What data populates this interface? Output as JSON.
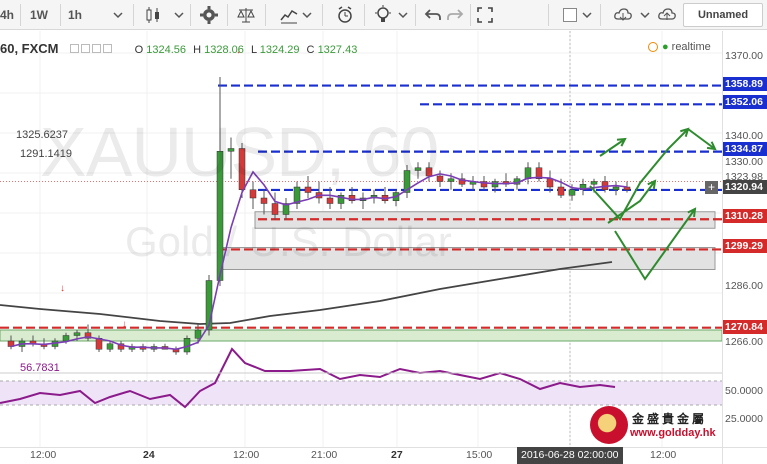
{
  "toolbar": {
    "items": [
      {
        "label": "4h"
      },
      {
        "label": "1W"
      },
      {
        "label": "1h"
      }
    ],
    "profile": "Unnamed"
  },
  "legend": {
    "symbol": "60, FXCM",
    "o_key": "O",
    "o_val": "1324.56",
    "h_key": "H",
    "h_val": "1328.06",
    "l_key": "L",
    "l_val": "1324.29",
    "c_key": "C",
    "c_val": "1327.43",
    "study1": "1325.6237",
    "study2": "1291.1419",
    "realtime": "realtime"
  },
  "watermark": {
    "symbol": "XAUUSD, 60",
    "desc": "Gold / U.S. Dollar"
  },
  "rsi": {
    "value": "56.7831"
  },
  "price_axis": {
    "ticks": [
      "1370.00",
      "1340.00",
      "1330.00",
      "1286.00",
      "1266.00",
      "50.0000",
      "25.0000"
    ],
    "labels": {
      "blue1": "1358.89",
      "blue2": "1352.06",
      "blue3": "1334.87",
      "current": "1320.94",
      "red1": "1310.28",
      "red2": "1299.29",
      "red3": "1270.84",
      "gray": "1323.98"
    }
  },
  "time_axis": {
    "ticks": [
      "12:00",
      "24",
      "12:00",
      "21:00",
      "27",
      "15:00",
      "12:00"
    ],
    "cursor": "2016-06-28 02:00:00"
  },
  "logo": {
    "cn": "金盛貴金屬",
    "url": "www.goldday.hk"
  },
  "colors": {
    "blue": "#1a2fd0",
    "red": "#d42a2a",
    "green": "#2e8b2e",
    "candle_red": "#d43a3a",
    "candle_green": "#3a9a3a",
    "rsi": "#8b1a8b"
  },
  "chart_data": {
    "type": "candlestick",
    "x": [
      "12:00",
      "24",
      "12:00",
      "21:00",
      "27",
      "15:00",
      "12:00"
    ],
    "ylim": [
      1260,
      1372
    ],
    "levels": [
      {
        "price": 1358.89,
        "color": "blue"
      },
      {
        "price": 1352.06,
        "color": "blue"
      },
      {
        "price": 1334.87,
        "color": "blue"
      },
      {
        "price": 1320.94,
        "color": "blue"
      },
      {
        "price": 1310.28,
        "color": "red"
      },
      {
        "price": 1299.29,
        "color": "red"
      },
      {
        "price": 1270.84,
        "color": "red"
      }
    ],
    "candles": [
      {
        "o": 1266,
        "h": 1268,
        "l": 1263,
        "c": 1264
      },
      {
        "o": 1264,
        "h": 1267,
        "l": 1262,
        "c": 1266
      },
      {
        "o": 1266,
        "h": 1268,
        "l": 1264,
        "c": 1265
      },
      {
        "o": 1265,
        "h": 1267,
        "l": 1263,
        "c": 1264
      },
      {
        "o": 1264,
        "h": 1267,
        "l": 1263,
        "c": 1266
      },
      {
        "o": 1266,
        "h": 1269,
        "l": 1265,
        "c": 1268
      },
      {
        "o": 1268,
        "h": 1270,
        "l": 1266,
        "c": 1269
      },
      {
        "o": 1269,
        "h": 1272,
        "l": 1266,
        "c": 1267
      },
      {
        "o": 1267,
        "h": 1268,
        "l": 1262,
        "c": 1263
      },
      {
        "o": 1263,
        "h": 1266,
        "l": 1262,
        "c": 1265
      },
      {
        "o": 1265,
        "h": 1266,
        "l": 1262,
        "c": 1263
      },
      {
        "o": 1263,
        "h": 1265,
        "l": 1262,
        "c": 1264
      },
      {
        "o": 1264,
        "h": 1265,
        "l": 1262,
        "c": 1263
      },
      {
        "o": 1263,
        "h": 1265,
        "l": 1262,
        "c": 1264
      },
      {
        "o": 1264,
        "h": 1265,
        "l": 1263,
        "c": 1263
      },
      {
        "o": 1263,
        "h": 1264,
        "l": 1261,
        "c": 1262
      },
      {
        "o": 1262,
        "h": 1268,
        "l": 1261,
        "c": 1267
      },
      {
        "o": 1267,
        "h": 1272,
        "l": 1265,
        "c": 1270
      },
      {
        "o": 1270,
        "h": 1290,
        "l": 1268,
        "c": 1288
      },
      {
        "o": 1288,
        "h": 1362,
        "l": 1286,
        "c": 1335
      },
      {
        "o": 1335,
        "h": 1340,
        "l": 1325,
        "c": 1336
      },
      {
        "o": 1336,
        "h": 1338,
        "l": 1318,
        "c": 1321
      },
      {
        "o": 1321,
        "h": 1324,
        "l": 1314,
        "c": 1318
      },
      {
        "o": 1318,
        "h": 1321,
        "l": 1312,
        "c": 1316
      },
      {
        "o": 1316,
        "h": 1320,
        "l": 1310,
        "c": 1312
      },
      {
        "o": 1312,
        "h": 1318,
        "l": 1310,
        "c": 1316
      },
      {
        "o": 1316,
        "h": 1324,
        "l": 1314,
        "c": 1322
      },
      {
        "o": 1322,
        "h": 1326,
        "l": 1318,
        "c": 1320
      },
      {
        "o": 1320,
        "h": 1324,
        "l": 1316,
        "c": 1318
      },
      {
        "o": 1318,
        "h": 1322,
        "l": 1314,
        "c": 1316
      },
      {
        "o": 1316,
        "h": 1320,
        "l": 1314,
        "c": 1319
      },
      {
        "o": 1319,
        "h": 1322,
        "l": 1316,
        "c": 1317
      },
      {
        "o": 1317,
        "h": 1320,
        "l": 1314,
        "c": 1318
      },
      {
        "o": 1318,
        "h": 1321,
        "l": 1316,
        "c": 1319
      },
      {
        "o": 1319,
        "h": 1322,
        "l": 1316,
        "c": 1317
      },
      {
        "o": 1317,
        "h": 1321,
        "l": 1315,
        "c": 1320
      },
      {
        "o": 1320,
        "h": 1330,
        "l": 1318,
        "c": 1328
      },
      {
        "o": 1328,
        "h": 1331,
        "l": 1325,
        "c": 1329
      },
      {
        "o": 1329,
        "h": 1331,
        "l": 1324,
        "c": 1326
      },
      {
        "o": 1326,
        "h": 1328,
        "l": 1322,
        "c": 1324
      },
      {
        "o": 1324,
        "h": 1327,
        "l": 1321,
        "c": 1325
      },
      {
        "o": 1325,
        "h": 1327,
        "l": 1322,
        "c": 1323
      },
      {
        "o": 1323,
        "h": 1326,
        "l": 1321,
        "c": 1324
      },
      {
        "o": 1324,
        "h": 1326,
        "l": 1321,
        "c": 1322
      },
      {
        "o": 1322,
        "h": 1325,
        "l": 1320,
        "c": 1324
      },
      {
        "o": 1324,
        "h": 1327,
        "l": 1322,
        "c": 1323
      },
      {
        "o": 1323,
        "h": 1326,
        "l": 1321,
        "c": 1325
      },
      {
        "o": 1325,
        "h": 1331,
        "l": 1323,
        "c": 1329
      },
      {
        "o": 1329,
        "h": 1331,
        "l": 1324,
        "c": 1325
      },
      {
        "o": 1325,
        "h": 1328,
        "l": 1320,
        "c": 1322
      },
      {
        "o": 1322,
        "h": 1325,
        "l": 1318,
        "c": 1319
      },
      {
        "o": 1319,
        "h": 1323,
        "l": 1317,
        "c": 1321
      },
      {
        "o": 1321,
        "h": 1325,
        "l": 1319,
        "c": 1323
      },
      {
        "o": 1323,
        "h": 1325,
        "l": 1320,
        "c": 1324
      },
      {
        "o": 1324,
        "h": 1326,
        "l": 1320,
        "c": 1321
      },
      {
        "o": 1321,
        "h": 1324,
        "l": 1319,
        "c": 1322
      },
      {
        "o": 1322,
        "h": 1324,
        "l": 1320,
        "c": 1321
      }
    ]
  }
}
